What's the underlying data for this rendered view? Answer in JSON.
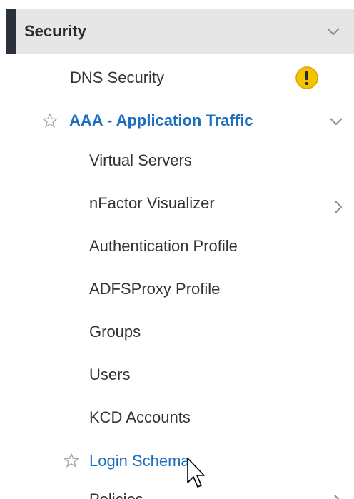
{
  "security": {
    "label": "Security",
    "toggle_icon": "chevron-down-icon"
  },
  "dns_security": {
    "label": "DNS Security",
    "status_icon": "warning-icon",
    "status_color": "#f5c400"
  },
  "aaa": {
    "label": "AAA - Application Traffic",
    "favorite_icon": "star-icon",
    "toggle_icon": "chevron-down-icon",
    "color": "#1f6fbf"
  },
  "aaa_items": [
    {
      "label": "Virtual Servers"
    },
    {
      "label": "nFactor Visualizer",
      "expand_icon": "chevron-right-icon"
    },
    {
      "label": "Authentication Profile"
    },
    {
      "label": "ADFSProxy Profile"
    },
    {
      "label": "Groups"
    },
    {
      "label": "Users"
    },
    {
      "label": "KCD Accounts"
    }
  ],
  "login_schema": {
    "label": "Login Schema",
    "favorite_icon": "star-icon",
    "color": "#1f6fbf"
  },
  "policies": {
    "label": "Policies",
    "expand_icon": "chevron-right-icon"
  },
  "pointer": "mouse-pointer-icon"
}
